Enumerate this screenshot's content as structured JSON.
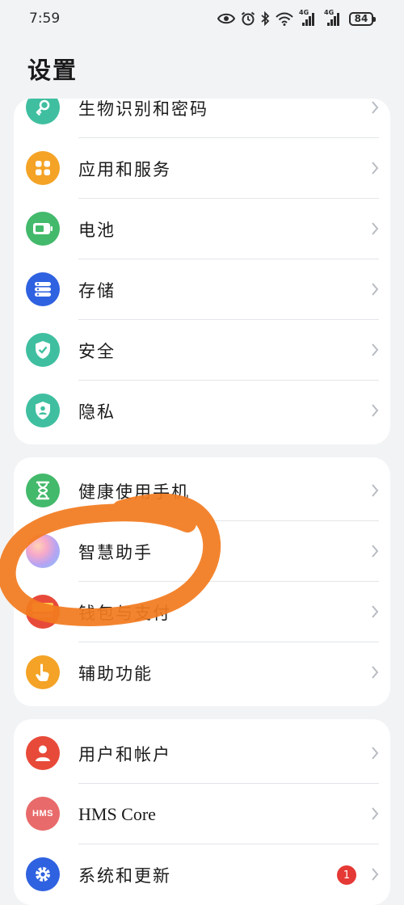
{
  "status_bar": {
    "time": "7:59",
    "icons": [
      "eye-icon",
      "alarm-icon",
      "bluetooth-icon",
      "wifi-icon",
      "signal-4g-icon",
      "signal-4g-icon",
      "battery-icon"
    ],
    "network_label_1": "4G",
    "network_label_2": "4G",
    "battery": "84"
  },
  "page": {
    "title": "设置"
  },
  "groups": [
    {
      "items": [
        {
          "label": "生物识别和密码",
          "icon": "key-icon",
          "color": "#3fbfa0"
        },
        {
          "label": "应用和服务",
          "icon": "apps-grid-icon",
          "color": "#f4a326"
        },
        {
          "label": "电池",
          "icon": "battery-icon",
          "color": "#43b96b"
        },
        {
          "label": "存储",
          "icon": "storage-icon",
          "color": "#2f62e0"
        },
        {
          "label": "安全",
          "icon": "shield-check-icon",
          "color": "#3fbfa0"
        },
        {
          "label": "隐私",
          "icon": "privacy-shield-icon",
          "color": "#3fbfa0"
        }
      ]
    },
    {
      "items": [
        {
          "label": "健康使用手机",
          "icon": "hourglass-icon",
          "color": "#43b96b"
        },
        {
          "label": "智慧助手",
          "icon": "smart-assistant-icon",
          "color": "#c9a4f2"
        },
        {
          "label": "钱包与支付",
          "icon": "huawei-wallet-icon",
          "color": "#e84a3a",
          "brand": "HUAWEI"
        },
        {
          "label": "辅助功能",
          "icon": "hand-touch-icon",
          "color": "#f4a326"
        }
      ]
    },
    {
      "items": [
        {
          "label": "用户和帐户",
          "icon": "user-icon",
          "color": "#e84a3a"
        },
        {
          "label": "HMS Core",
          "icon": "hms-core-icon",
          "color": "#e86a6a",
          "brand": "HMS"
        },
        {
          "label": "系统和更新",
          "icon": "gear-icon",
          "color": "#2f62e0",
          "badge": "1"
        }
      ]
    }
  ],
  "annotation": {
    "color": "#f27b1f"
  }
}
